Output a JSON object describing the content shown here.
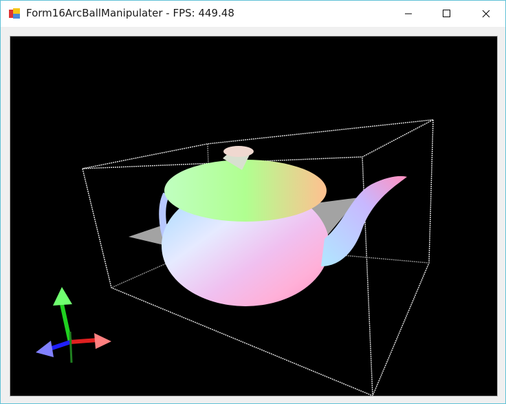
{
  "window": {
    "title": "Form16ArcBallManipulater - FPS: 449.48",
    "controls": [
      "minimize",
      "maximize",
      "close"
    ]
  },
  "viewport": {
    "scene": "teapot-with-bounding-box",
    "axis_colors": {
      "x": "#ff2020",
      "y": "#20d020",
      "z": "#2020ff"
    }
  }
}
